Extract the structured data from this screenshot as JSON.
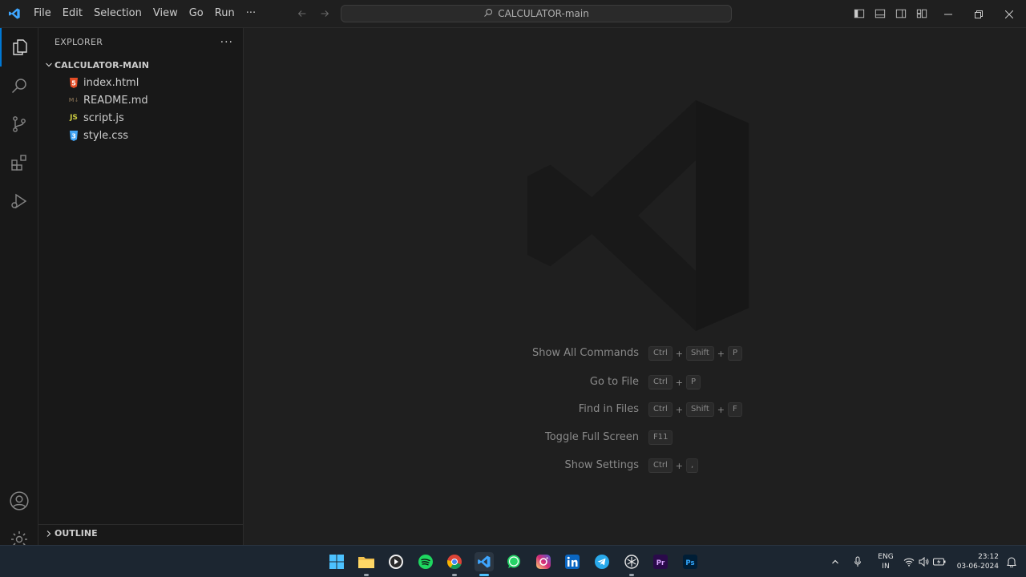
{
  "titlebar": {
    "menu": [
      "File",
      "Edit",
      "Selection",
      "View",
      "Go",
      "Run",
      "···"
    ],
    "search_text": "CALCULATOR-main"
  },
  "sidebar": {
    "title": "EXPLORER",
    "more": "···",
    "folder": "CALCULATOR-MAIN",
    "files": [
      {
        "name": "index.html",
        "type": "html",
        "icon_label": "5",
        "color": "#e44d26"
      },
      {
        "name": "README.md",
        "type": "markdown",
        "icon_label": "M↓",
        "color": "#6a5a45"
      },
      {
        "name": "script.js",
        "type": "javascript",
        "icon_label": "JS",
        "color": "#cbcb41"
      },
      {
        "name": "style.css",
        "type": "css",
        "icon_label": "3",
        "color": "#42a5f5"
      }
    ],
    "outline_label": "OUTLINE"
  },
  "editor": {
    "shortcuts": [
      {
        "label": "Show All Commands",
        "keys": [
          "Ctrl",
          "Shift",
          "P"
        ]
      },
      {
        "label": "Go to File",
        "keys": [
          "Ctrl",
          "P"
        ]
      },
      {
        "label": "Find in Files",
        "keys": [
          "Ctrl",
          "Shift",
          "F"
        ]
      },
      {
        "label": "Toggle Full Screen",
        "keys": [
          "F11"
        ]
      },
      {
        "label": "Show Settings",
        "keys": [
          "Ctrl",
          ","
        ]
      }
    ],
    "key_separator": "+"
  },
  "taskbar": {
    "apps": [
      "windows-start",
      "file-explorer",
      "media-player",
      "spotify",
      "chrome",
      "vscode",
      "whatsapp",
      "instagram",
      "linkedin",
      "telegram",
      "chatgpt",
      "premiere-pro",
      "photoshop"
    ],
    "active_app": "vscode",
    "language_line1": "ENG",
    "language_line2": "IN",
    "time": "23:12",
    "date": "03-06-2024"
  },
  "colors": {
    "accent": "#0078d4",
    "editor_bg": "#1f1f1f",
    "sidebar_bg": "#181818",
    "taskbar_bg": "#1c2631"
  }
}
